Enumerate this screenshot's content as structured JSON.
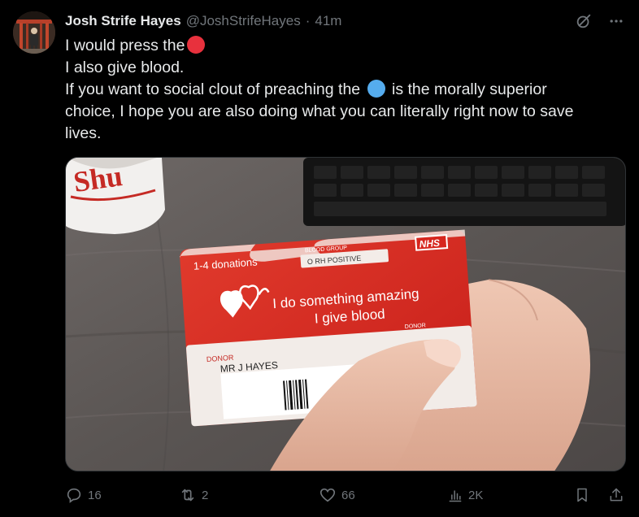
{
  "tweet": {
    "author": {
      "display_name": "Josh Strife Hayes",
      "handle": "@JoshStrifeHayes",
      "separator": "·",
      "time": "41m"
    },
    "text": {
      "line1": "I would press the",
      "line1_emoji": "red-circle",
      "line2": "I also give blood.",
      "line3_before": "If you want to social clout of preaching the",
      "line3_emoji": "blue-circle",
      "line3_after": "is the morally superior",
      "line4": "choice, I hope you are also doing what you can literally right now to save",
      "line5": "lives."
    },
    "media": {
      "card": {
        "donations": "1-4 donations",
        "group": "BLOOD GROUP",
        "blood_type": "O RH POSITIVE",
        "nhs": "NHS",
        "slogan_line1": "I do something amazing",
        "slogan_line2": "I give blood",
        "donor_label": "DONOR",
        "donor_name": "MR J HAYES",
        "cut_label": "DONOR"
      },
      "mug_text": "Shu"
    },
    "stats": {
      "replies": "16",
      "reposts": "2",
      "likes": "66",
      "views": "2K"
    }
  },
  "colors": {
    "background": "#000000",
    "text_primary": "#e7e9ea",
    "text_secondary": "#71767b",
    "emoji_red": "#e8313d",
    "emoji_blue": "#55acee",
    "card_red": "#d7261e"
  }
}
